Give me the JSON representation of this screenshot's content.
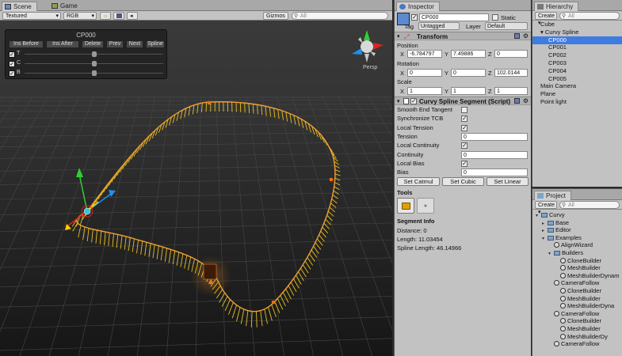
{
  "scene": {
    "tabs": [
      {
        "label": "Scene"
      },
      {
        "label": "Game"
      }
    ],
    "toolbar": {
      "render_mode": "Textured",
      "color_mode": "RGB",
      "gizmos": "Gizmos ▾",
      "search_placeholder": "All"
    },
    "curvy_panel": {
      "title": "CP000",
      "buttons": [
        "Ins Before",
        "Ins After",
        "Delete",
        "Prev",
        "Next",
        "Spline"
      ],
      "sliders": [
        {
          "label": "T",
          "value": 0.5
        },
        {
          "label": "C",
          "value": 0.5
        },
        {
          "label": "B",
          "value": 0.5
        }
      ]
    },
    "persp_label": "Persp",
    "colors": {
      "spline": "#f0a030",
      "ticks": "#e8c020",
      "grid": "#4a4a4a",
      "handle_x": "#e02020",
      "handle_y": "#30d030",
      "handle_z": "#2090f0"
    }
  },
  "inspector": {
    "tab": "Inspector",
    "object_name": "CP000",
    "static_label": "Static",
    "tag_label": "Tag",
    "tag_value": "Untagged",
    "layer_label": "Layer",
    "layer_value": "Default",
    "transform": {
      "title": "Transform",
      "position_label": "Position",
      "rotation_label": "Rotation",
      "scale_label": "Scale",
      "position": {
        "x": "-6.784797",
        "y": "7.49886",
        "z": "0"
      },
      "rotation": {
        "x": "0",
        "y": "0",
        "z": "102.0144"
      },
      "scale": {
        "x": "1",
        "y": "1",
        "z": "1"
      }
    },
    "segment": {
      "title": "Curvy Spline Segment (Script)",
      "rows": [
        {
          "label": "Smooth End Tangent",
          "kind": "check",
          "checked": false
        },
        {
          "label": "Synchronize TCB",
          "kind": "check",
          "checked": true
        },
        {
          "label": "Local Tension",
          "kind": "check",
          "checked": true
        },
        {
          "label": "Tension",
          "kind": "field",
          "value": "0"
        },
        {
          "label": "Local Continuity",
          "kind": "check",
          "checked": true
        },
        {
          "label": "Continuity",
          "kind": "field",
          "value": "0"
        },
        {
          "label": "Local Bias",
          "kind": "check",
          "checked": true
        },
        {
          "label": "Bias",
          "kind": "field",
          "value": "0"
        }
      ],
      "buttons": [
        "Set Catmul",
        "Set Cubic",
        "Set Linear"
      ]
    },
    "tools_label": "Tools",
    "segment_info": {
      "title": "Segment Info",
      "distance": "Distance: 0",
      "length": "Length: 11.03454",
      "spline_length": "Spline Length: 46.14966"
    }
  },
  "hierarchy": {
    "tab": "Hierarchy",
    "create_label": "Create ▾",
    "search_placeholder": "All",
    "items": [
      {
        "label": "Cube",
        "indent": 0
      },
      {
        "label": "▾ Curvy Spline",
        "indent": 0
      },
      {
        "label": "CP000",
        "indent": 2,
        "selected": true
      },
      {
        "label": "CP001",
        "indent": 2
      },
      {
        "label": "CP002",
        "indent": 2
      },
      {
        "label": "CP003",
        "indent": 2
      },
      {
        "label": "CP004",
        "indent": 2
      },
      {
        "label": "CP005",
        "indent": 2
      },
      {
        "label": "Main Camera",
        "indent": 0
      },
      {
        "label": "Plane",
        "indent": 0
      },
      {
        "label": "Point light",
        "indent": 0
      }
    ]
  },
  "project": {
    "tab": "Project",
    "create_label": "Create ▾",
    "search_placeholder": "All",
    "items": [
      {
        "label": "Curvy",
        "indent": 0,
        "type": "folder",
        "arrow": "▾"
      },
      {
        "label": "Base",
        "indent": 1,
        "type": "folder",
        "arrow": "▸"
      },
      {
        "label": "Editor",
        "indent": 1,
        "type": "folder",
        "arrow": "▸"
      },
      {
        "label": "Examples",
        "indent": 1,
        "type": "folder",
        "arrow": "▾"
      },
      {
        "label": "AlignWizard",
        "indent": 2,
        "type": "script",
        "arrow": ""
      },
      {
        "label": "Builders",
        "indent": 2,
        "type": "folder",
        "arrow": "▾"
      },
      {
        "label": "CloneBuilder",
        "indent": 3,
        "type": "script",
        "arrow": ""
      },
      {
        "label": "MeshBuilder",
        "indent": 3,
        "type": "script",
        "arrow": ""
      },
      {
        "label": "MeshBuilderDynam",
        "indent": 3,
        "type": "script",
        "arrow": ""
      },
      {
        "label": "CameraFollow",
        "indent": 2,
        "type": "script",
        "arrow": ""
      },
      {
        "label": "CloneBuilder",
        "indent": 3,
        "type": "script",
        "arrow": ""
      },
      {
        "label": "MeshBuilder",
        "indent": 3,
        "type": "script",
        "arrow": ""
      },
      {
        "label": "MeshBuilderDyna",
        "indent": 3,
        "type": "script",
        "arrow": ""
      },
      {
        "label": "CameraFollow",
        "indent": 2,
        "type": "script",
        "arrow": ""
      },
      {
        "label": "CloneBuilder",
        "indent": 3,
        "type": "script",
        "arrow": ""
      },
      {
        "label": "MeshBuilder",
        "indent": 3,
        "type": "script",
        "arrow": ""
      },
      {
        "label": "MeshBuilderDy",
        "indent": 3,
        "type": "script",
        "arrow": ""
      },
      {
        "label": "CameraFollow",
        "indent": 2,
        "type": "script",
        "arrow": ""
      }
    ]
  }
}
